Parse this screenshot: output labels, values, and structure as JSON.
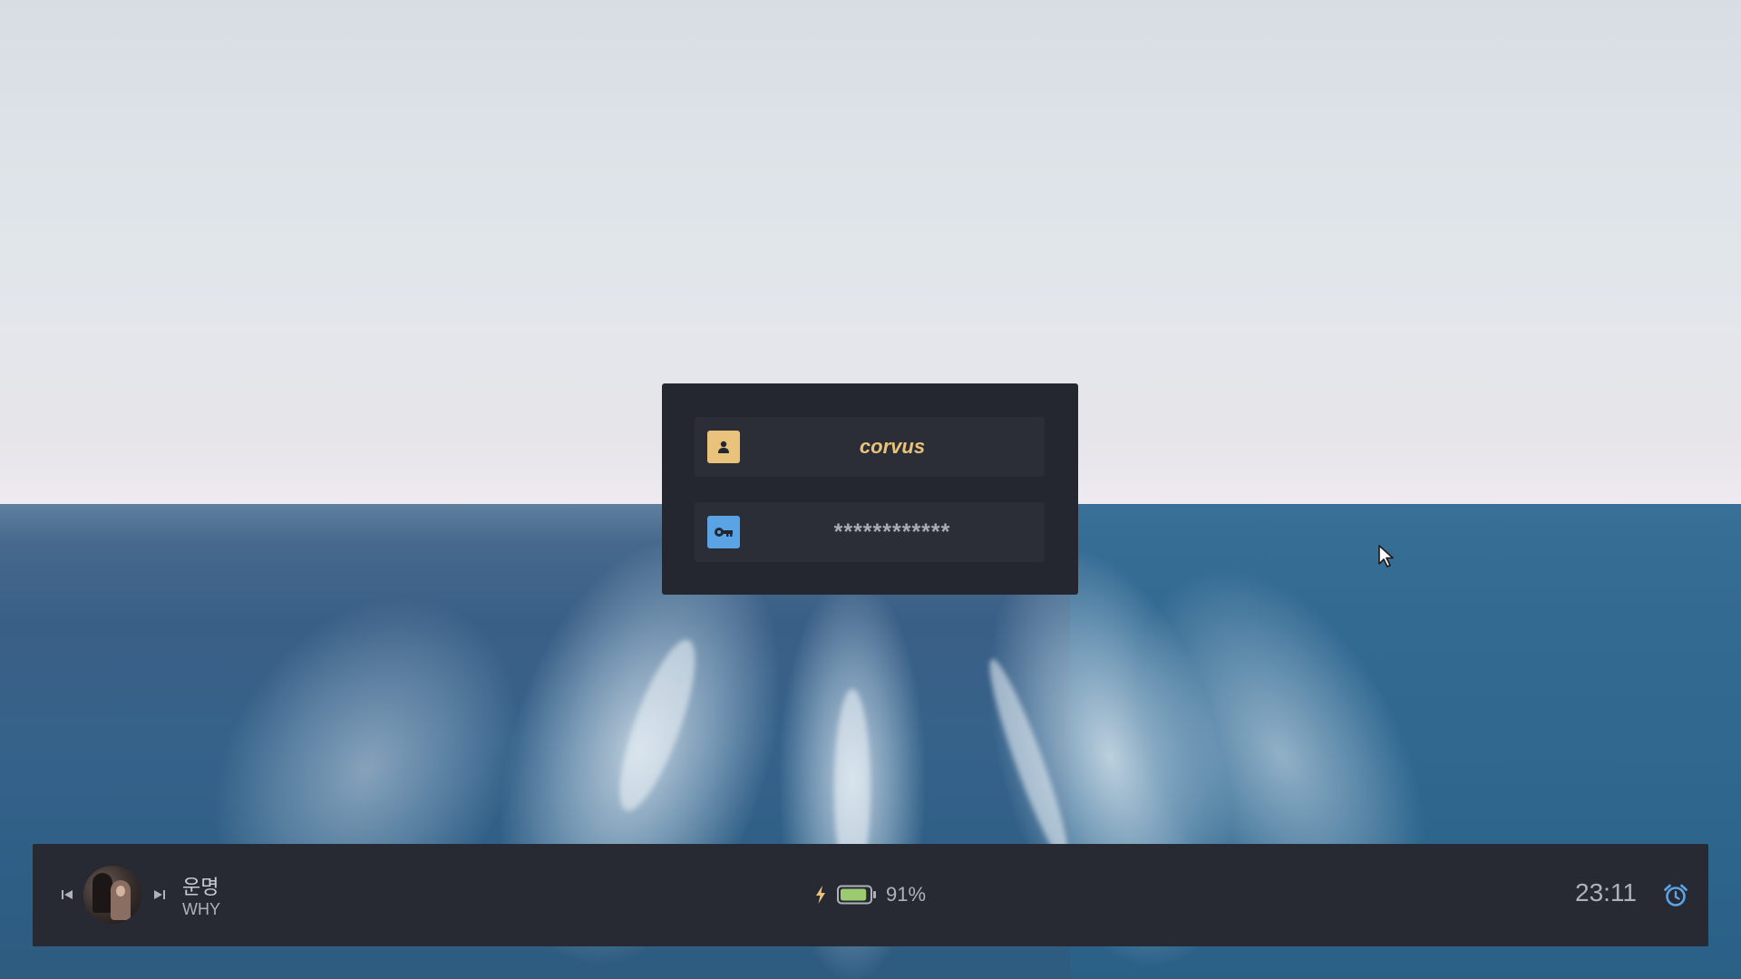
{
  "login": {
    "username": "corvus",
    "password_masked": "************"
  },
  "media": {
    "track_title": "운명",
    "track_artist": "WHY"
  },
  "status": {
    "battery_percent_label": "91%",
    "battery_level": 0.91,
    "charging": true,
    "clock": "23:11"
  },
  "icons": {
    "user": "user-icon",
    "password": "key-icon",
    "previous": "skip-previous-icon",
    "next": "skip-next-icon",
    "charging": "lightning-bolt-icon",
    "battery": "battery-icon",
    "alarm": "alarm-clock-icon",
    "pointer": "mouse-pointer-icon"
  },
  "colors": {
    "accent_yellow": "#e9c27b",
    "accent_blue": "#5aa4e6",
    "battery_fill": "#9cca6e",
    "panel_bg": "#24272f",
    "bar_bg": "#272a33"
  }
}
